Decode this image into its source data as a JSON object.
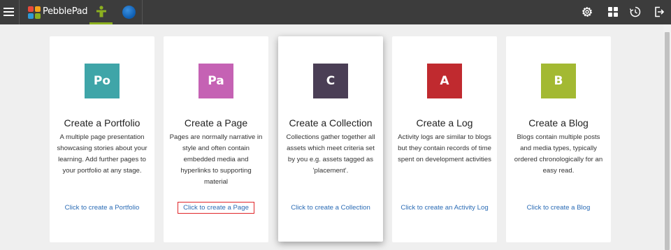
{
  "header": {
    "brand": "PebblePad"
  },
  "colors": {
    "topbar": "#3c3c3c",
    "accent_underline": "#8cb01f",
    "link": "#2a6bb5"
  },
  "cards": [
    {
      "tile": "Po",
      "color": "#3fa5a8",
      "title": "Create a Portfolio",
      "description": "A multiple page presentation showcasing stories about your learning. Add further pages to your portfolio at any stage.",
      "link": "Click to create a Portfolio"
    },
    {
      "tile": "Pa",
      "color": "#c562b4",
      "title": "Create a Page",
      "description": "Pages are normally narrative in style and often contain embedded media and hyperlinks to supporting material",
      "link": "Click to create a Page"
    },
    {
      "tile": "C",
      "color": "#4a3e55",
      "title": "Create a Collection",
      "description": "Collections gather together all assets which meet criteria set by you e.g. assets tagged as 'placement'.",
      "link": "Click to create a Collection"
    },
    {
      "tile": "A",
      "color": "#c02a2f",
      "title": "Create a Log",
      "description": "Activity logs are similar to blogs but they contain records of time spent on development activities",
      "link": "Click to create an Activity Log"
    },
    {
      "tile": "B",
      "color": "#a3b932",
      "title": "Create a Blog",
      "description": "Blogs contain multiple posts and media types, typically ordered chronologically for an easy read.",
      "link": "Click to create a Blog"
    }
  ]
}
